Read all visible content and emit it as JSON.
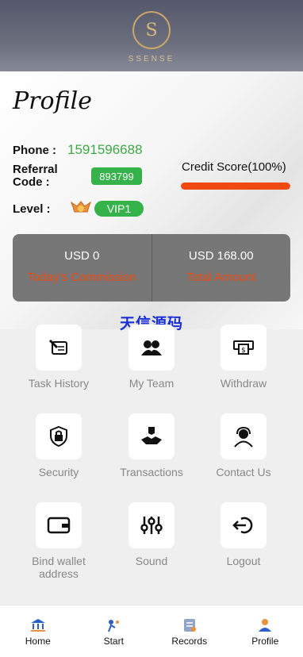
{
  "brand": {
    "logo_letter": "S",
    "name": "SSENSE"
  },
  "profile": {
    "title": "Profile",
    "phone_label": "Phone :",
    "phone": "1591596688",
    "referral_label_1": "Referral",
    "referral_label_2": "Code :",
    "referral_code": "893799",
    "credit_label": "Credit Score(100%)",
    "credit_fraction": 1.0,
    "level_label": "Level :",
    "vip": "VIP1"
  },
  "stats": [
    {
      "value": "USD 0",
      "label": "Today's Commission"
    },
    {
      "value": "USD 168.00",
      "label": "Total Amount"
    }
  ],
  "watermark": "天信源码",
  "menu": [
    {
      "label": "Task History",
      "icon": "scroll-quill-icon"
    },
    {
      "label": "My Team",
      "icon": "team-icon"
    },
    {
      "label": "Withdraw",
      "icon": "cash-icon"
    },
    {
      "label": "Security",
      "icon": "shield-lock-icon"
    },
    {
      "label": "Transactions",
      "icon": "handshake-icon"
    },
    {
      "label": "Contact Us",
      "icon": "headset-icon"
    },
    {
      "label": "Bind wallet address",
      "icon": "wallet-icon"
    },
    {
      "label": "Sound",
      "icon": "sliders-icon"
    },
    {
      "label": "Logout",
      "icon": "logout-icon"
    }
  ],
  "nav": [
    {
      "label": "Home",
      "icon": "bank-icon"
    },
    {
      "label": "Start",
      "icon": "start-icon"
    },
    {
      "label": "Records",
      "icon": "records-icon"
    },
    {
      "label": "Profile",
      "icon": "user-icon",
      "active": true
    }
  ],
  "colors": {
    "accent_green": "#36b24a",
    "accent_orange": "#f04a10",
    "gold": "#c9a56a"
  }
}
